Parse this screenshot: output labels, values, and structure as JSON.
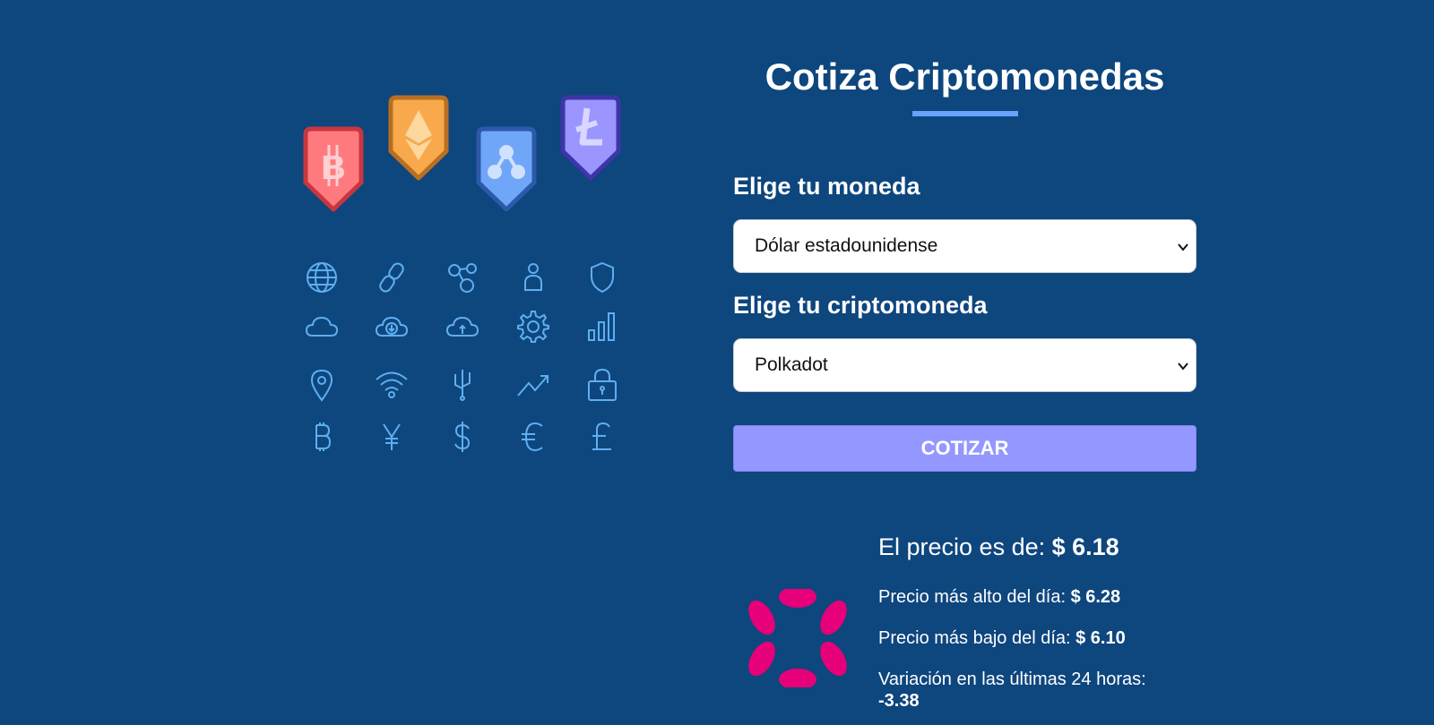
{
  "page": {
    "title": "Cotiza Criptomonedas"
  },
  "form": {
    "currency_label": "Elige tu moneda",
    "currency_selected": "Dólar estadounidense",
    "crypto_label": "Elige tu criptomoneda",
    "crypto_selected": "Polkadot",
    "submit_label": "Cotizar"
  },
  "result": {
    "price_label": "El precio es de:",
    "price_value": "$ 6.18",
    "high_label": "Precio más alto del día:",
    "high_value": "$ 6.28",
    "low_label": "Precio más bajo del día:",
    "low_value": "$ 6.10",
    "change_label": "Variación en las últimas 24 horas:",
    "change_value": "-3.38",
    "logo_icon": "polkadot-logo-icon"
  },
  "illustration": {
    "badges": [
      "bitcoin-badge-icon",
      "ethereum-badge-icon",
      "ripple-badge-icon",
      "litecoin-badge-icon"
    ],
    "grid_icons": [
      "globe-icon",
      "link-icon",
      "network-icon",
      "user-icon",
      "shield-icon",
      "cloud-icon",
      "cloud-download-icon",
      "cloud-upload-icon",
      "gear-icon",
      "signal-bars-icon",
      "location-pin-icon",
      "wifi-icon",
      "usb-icon",
      "trend-up-icon",
      "padlock-icon",
      "bitcoin-icon",
      "yen-icon",
      "dollar-icon",
      "euro-icon",
      "pound-icon"
    ]
  },
  "colors": {
    "background": "#0e467e",
    "accent_underline": "#66a2fe",
    "button": "#9497ff",
    "polkadot": "#e6007a",
    "icon_stroke": "#5eaff0"
  }
}
